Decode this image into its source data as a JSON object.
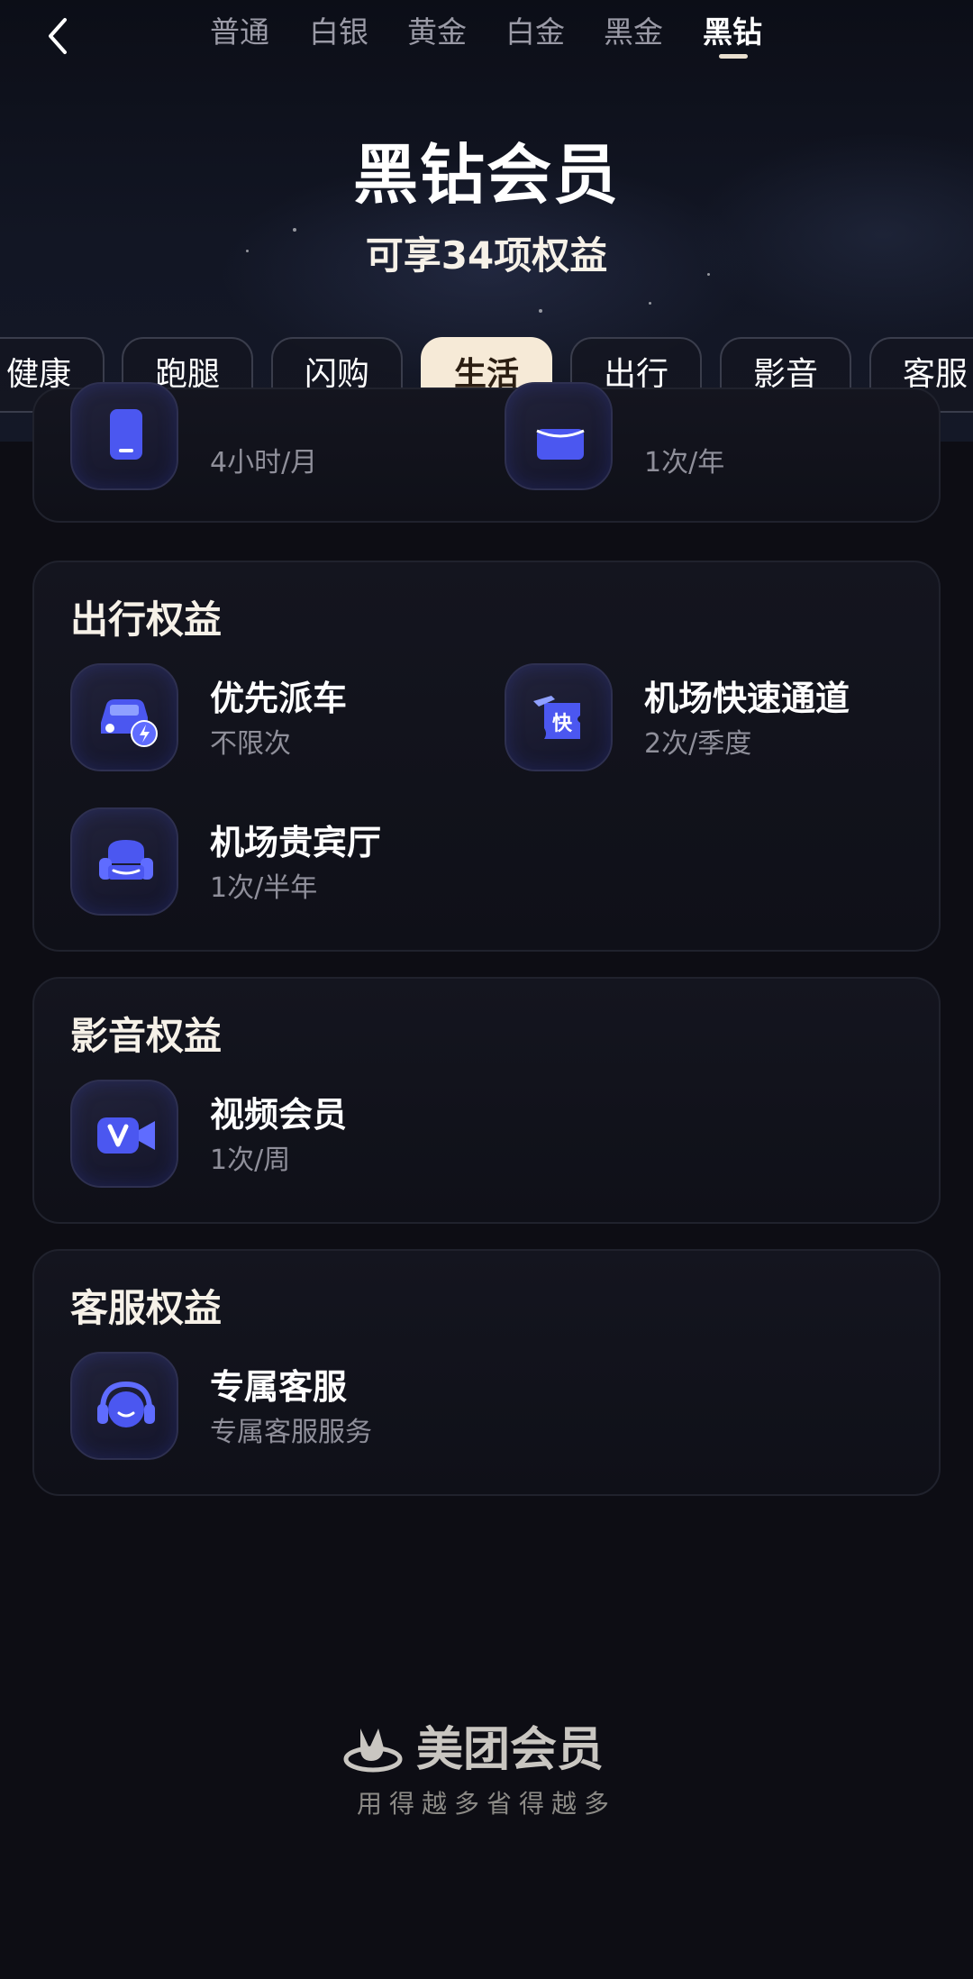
{
  "tiers": [
    "普通",
    "白银",
    "黄金",
    "白金",
    "黑金",
    "黑钻"
  ],
  "header": {
    "title": "黑钻会员",
    "subtitle": "可享34项权益"
  },
  "categories": [
    "健康",
    "跑腿",
    "闪购",
    "生活",
    "出行",
    "影音",
    "客服"
  ],
  "partial_card": {
    "items": [
      {
        "desc": "4小时/月",
        "icon": "phone-icon"
      },
      {
        "desc": "1次/年",
        "icon": "gift-icon"
      }
    ]
  },
  "travel": {
    "title": "出行权益",
    "items": [
      {
        "name": "优先派车",
        "desc": "不限次",
        "icon": "car-icon"
      },
      {
        "name": "机场快速通道",
        "desc": "2次/季度",
        "icon": "fast-lane-icon"
      },
      {
        "name": "机场贵宾厅",
        "desc": "1次/半年",
        "icon": "sofa-icon"
      }
    ]
  },
  "media": {
    "title": "影音权益",
    "items": [
      {
        "name": "视频会员",
        "desc": "1次/周",
        "icon": "video-icon"
      }
    ]
  },
  "service": {
    "title": "客服权益",
    "items": [
      {
        "name": "专属客服",
        "desc": "专属客服服务",
        "icon": "headset-icon"
      }
    ]
  },
  "footer": {
    "brand": "美团会员",
    "slogan": "用得越多省得越多"
  },
  "colors": {
    "accent": "#f6ead7",
    "icon_blue": "#4b57f0",
    "background": "#0d0d14"
  }
}
